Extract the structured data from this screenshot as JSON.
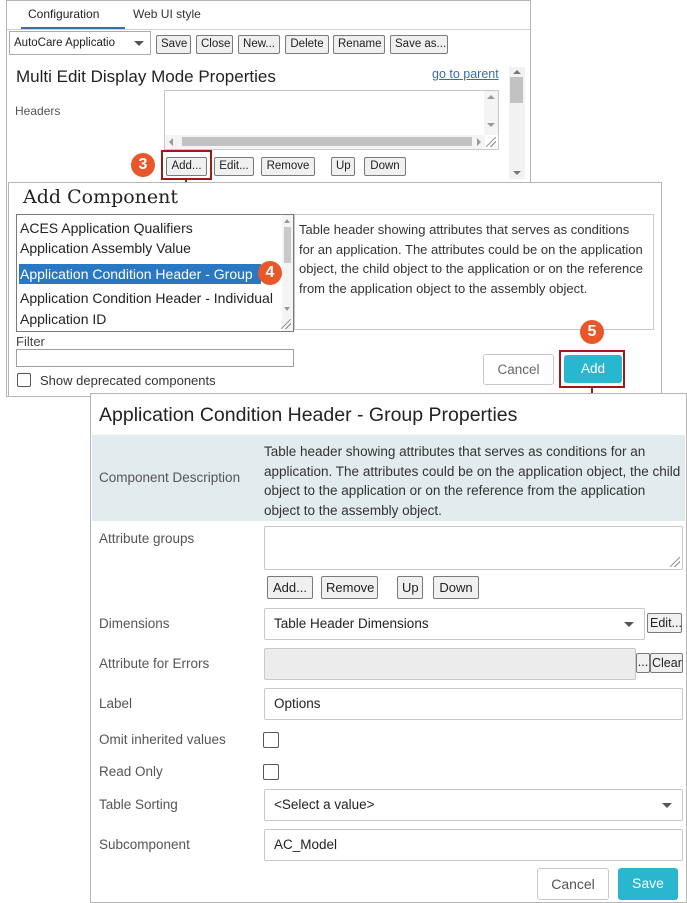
{
  "config": {
    "tabs": [
      "Configuration",
      "Web UI style"
    ],
    "app_select": "AutoCare Applicatio",
    "toolbar": [
      "Save",
      "Close",
      "New...",
      "Delete",
      "Rename",
      "Save as..."
    ],
    "title": "Multi Edit Display Mode Properties",
    "goto_parent": "go to parent",
    "headers_label": "Headers",
    "header_buttons": [
      "Add...",
      "Edit...",
      "Remove",
      "Up",
      "Down"
    ]
  },
  "steps": [
    "3",
    "4",
    "5"
  ],
  "add_component": {
    "title": "Add Component",
    "items": [
      "ACES Application Qualifiers",
      "Application Assembly Value",
      "Application Condition Header - Group",
      "Application Condition Header - Individual",
      "Application ID"
    ],
    "description": "Table header showing attributes that serves as conditions for an application. The attributes could be on the application object, the child object to the application or on the reference from the application object to the assembly object.",
    "filter_label": "Filter",
    "filter_value": "",
    "deprecated_label": "Show deprecated components",
    "cancel": "Cancel",
    "add": "Add"
  },
  "props": {
    "title": "Application Condition Header - Group Properties",
    "desc_label": "Component Description",
    "desc_text": "Table header showing attributes that serves as conditions for an application. The attributes could be on the application object, the child object to the application or on the reference from the application object to the assembly object.",
    "attr_groups_label": "Attribute groups",
    "attr_buttons": [
      "Add...",
      "Remove",
      "Up",
      "Down"
    ],
    "dimensions_label": "Dimensions",
    "dimensions_value": "Table Header Dimensions",
    "edit_btn": "Edit...",
    "attr_errors_label": "Attribute for Errors",
    "ellipsis_btn": "...",
    "clear_btn": "Clear",
    "label_label": "Label",
    "label_value": "Options",
    "omit_label": "Omit inherited values",
    "readonly_label": "Read Only",
    "sorting_label": "Table Sorting",
    "sorting_value": "<Select a value>",
    "subcomponent_label": "Subcomponent",
    "subcomponent_value": "AC_Model",
    "cancel": "Cancel",
    "save": "Save"
  }
}
